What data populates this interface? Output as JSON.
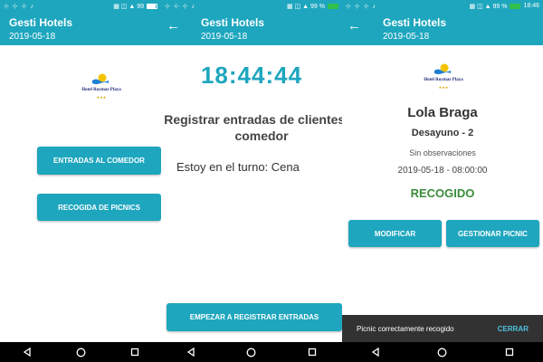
{
  "status_bar": {
    "left_icons": "⊹ ⊹ ⊹ ♪",
    "screen1": {
      "indicators": "▦ ◫ ▲ 99",
      "time": ""
    },
    "screen2": {
      "indicators": "▦ ◫ ▲ 99 %",
      "time": ""
    },
    "screen3": {
      "indicators": "▦ ◫ ▲ 99 %",
      "time": "18:46"
    }
  },
  "app": {
    "title": "Gesti Hotels",
    "date": "2019-05-18",
    "back_icon": "←"
  },
  "logo": {
    "name": "Hotel Roymar Playa",
    "stars": "★★★"
  },
  "screen1": {
    "buttons": [
      "ENTRADAS AL COMEDOR",
      "RECOGIDA DE PICNICS"
    ]
  },
  "screen2": {
    "clock": "18:44:44",
    "heading": "Registrar entradas de clientes al comedor",
    "turn_text": "Estoy en el turno: Cena",
    "start_button": "EMPEZAR A REGISTRAR ENTRADAS"
  },
  "screen3": {
    "guest_name": "Lola Braga",
    "meal": "Desayuno - 2",
    "observations": "Sin observaciones",
    "datetime": "2019-05-18 - 08:00:00",
    "status": "RECOGIDO",
    "modify_button": "MODIFICAR",
    "picnic_button": "GESTIONAR PICNIC",
    "snackbar_message": "Picnic correctamente recogido",
    "snackbar_action": "CERRAR"
  },
  "colors": {
    "primary": "#1ea6be",
    "success": "#3b8c3b",
    "snackbar": "#323232"
  },
  "nav_icons": [
    "back-triangle-icon",
    "home-circle-icon",
    "recents-square-icon"
  ]
}
